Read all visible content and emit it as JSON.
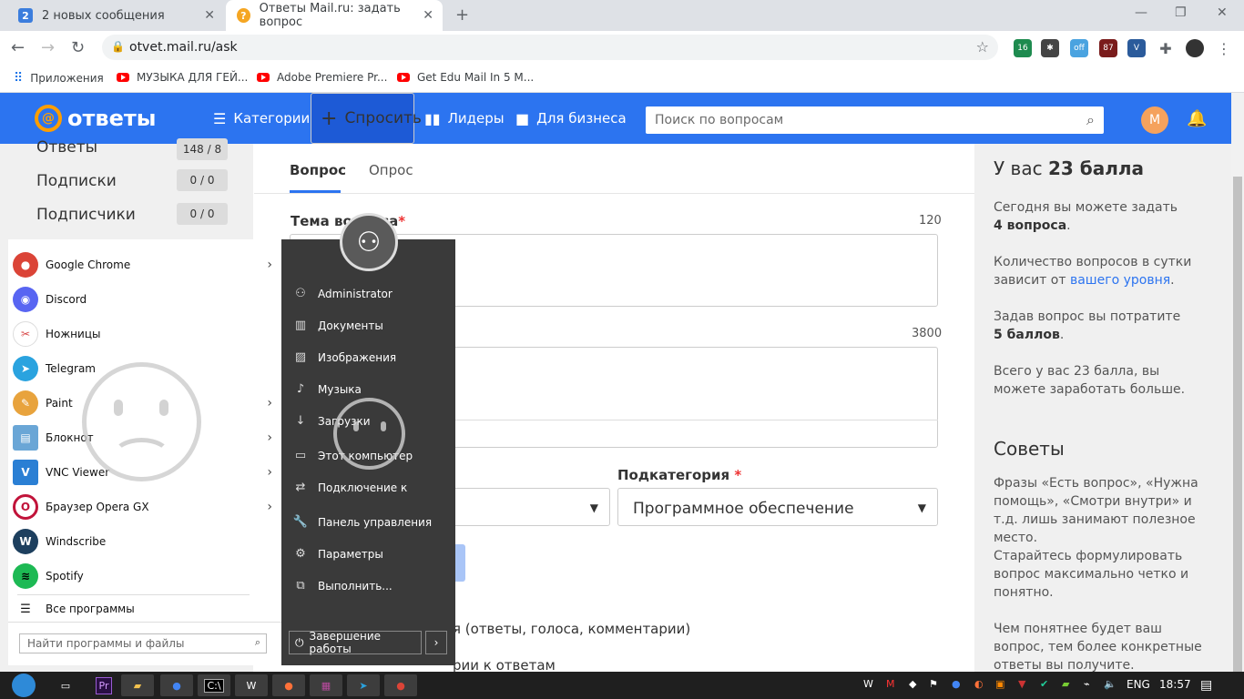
{
  "browser": {
    "tabs": [
      {
        "label": "2 новых сообщения",
        "badge": "2"
      },
      {
        "label": "Ответы Mail.ru: задать вопрос"
      }
    ],
    "url": "otvet.mail.ru/ask",
    "ext_badges": [
      "16",
      "off",
      "87"
    ],
    "bookmarks": [
      "Приложения",
      "МУЗЫКА ДЛЯ ГЕЙ...",
      "Adobe Premiere Pr...",
      "Get Edu Mail In 5 M..."
    ]
  },
  "site": {
    "logo": "ответы",
    "nav": [
      "Категории",
      "Спросить",
      "Лидеры",
      "Для бизнеса"
    ],
    "search_placeholder": "Поиск по вопросам",
    "avatar_letter": "М",
    "colors": {
      "header": "#2c74f0",
      "accent": "#ff9e00"
    }
  },
  "left_stats": [
    {
      "label": "Ответы",
      "value": "148 / 8"
    },
    {
      "label": "Подписки",
      "value": "0 / 0"
    },
    {
      "label": "Подписчики",
      "value": "0 / 0"
    }
  ],
  "form": {
    "tab_question": "Вопрос",
    "tab_poll": "Опрос",
    "topic_label": "Тема вопроса",
    "topic_counter": "120",
    "text_counter": "3800",
    "subcategory_label": "Подкатегория",
    "subcategory_value": "Программное обеспечение",
    "required_mark": "*",
    "notify_text": "я (ответы, голоса, комментарии)",
    "comments_text": "рии к ответам"
  },
  "sidebar": {
    "points_prefix": "У вас ",
    "points_bold": "23 балла",
    "today_line1": "Сегодня вы можете задать",
    "today_bold": "4 вопроса",
    "limit_text": "Количество вопросов в сутки зависит от ",
    "limit_link": "вашего уровня",
    "cost_text": "Задав вопрос вы потратите",
    "cost_bold": "5 баллов",
    "earn_text": "Всего у вас 23 балла, вы можете заработать больше.",
    "tips_title": "Советы",
    "tip1": "Фразы «Есть вопрос», «Нужна помощь», «Смотри внутри» и т.д. лишь занимают полезное место.",
    "tip2": "Старайтесь формулировать вопрос максимально четко и понятно.",
    "tip3": "Чем понятнее будет ваш вопрос, тем более конкретные ответы вы получите."
  },
  "startmenu": {
    "apps": [
      {
        "label": "Google Chrome",
        "icon": "chrome-icon",
        "color": "#db4437",
        "sub": true
      },
      {
        "label": "Discord",
        "icon": "discord-icon",
        "color": "#5865f2",
        "sub": false
      },
      {
        "label": "Ножницы",
        "icon": "scissors-icon",
        "color": "#d84a4a",
        "sub": false
      },
      {
        "label": "Telegram",
        "icon": "telegram-icon",
        "color": "#2aa3df",
        "sub": false
      },
      {
        "label": "Paint",
        "icon": "paint-icon",
        "color": "#e8a33d",
        "sub": true
      },
      {
        "label": "Блокнот",
        "icon": "notepad-icon",
        "color": "#6aa6d6",
        "sub": true
      },
      {
        "label": "VNC Viewer",
        "icon": "vnc-icon",
        "color": "#2a7fd4",
        "sub": true
      },
      {
        "label": "Браузер Opera GX",
        "icon": "opera-icon",
        "color": "#c1133a",
        "sub": true
      },
      {
        "label": "Windscribe",
        "icon": "windscribe-icon",
        "color": "#1d3f5e",
        "sub": false
      },
      {
        "label": "Spotify",
        "icon": "spotify-icon",
        "color": "#1db954",
        "sub": false
      }
    ],
    "all_programs": "Все программы",
    "search_placeholder": "Найти программы и файлы",
    "right_items": [
      {
        "label": "Administrator",
        "icon": "user-icon"
      },
      {
        "label": "Документы",
        "icon": "documents-icon"
      },
      {
        "label": "Изображения",
        "icon": "pictures-icon"
      },
      {
        "label": "Музыка",
        "icon": "music-icon"
      },
      {
        "label": "Загрузки",
        "icon": "downloads-icon"
      },
      {
        "label": "Этот компьютер",
        "icon": "computer-icon"
      },
      {
        "label": "Подключение к",
        "icon": "connect-icon"
      },
      {
        "label": "Панель управления",
        "icon": "control-panel-icon"
      },
      {
        "label": "Параметры",
        "icon": "settings-icon"
      },
      {
        "label": "Выполнить...",
        "icon": "run-icon"
      }
    ],
    "shutdown": "Завершение работы"
  },
  "taskbar": {
    "language": "ENG",
    "time": "18:57"
  }
}
